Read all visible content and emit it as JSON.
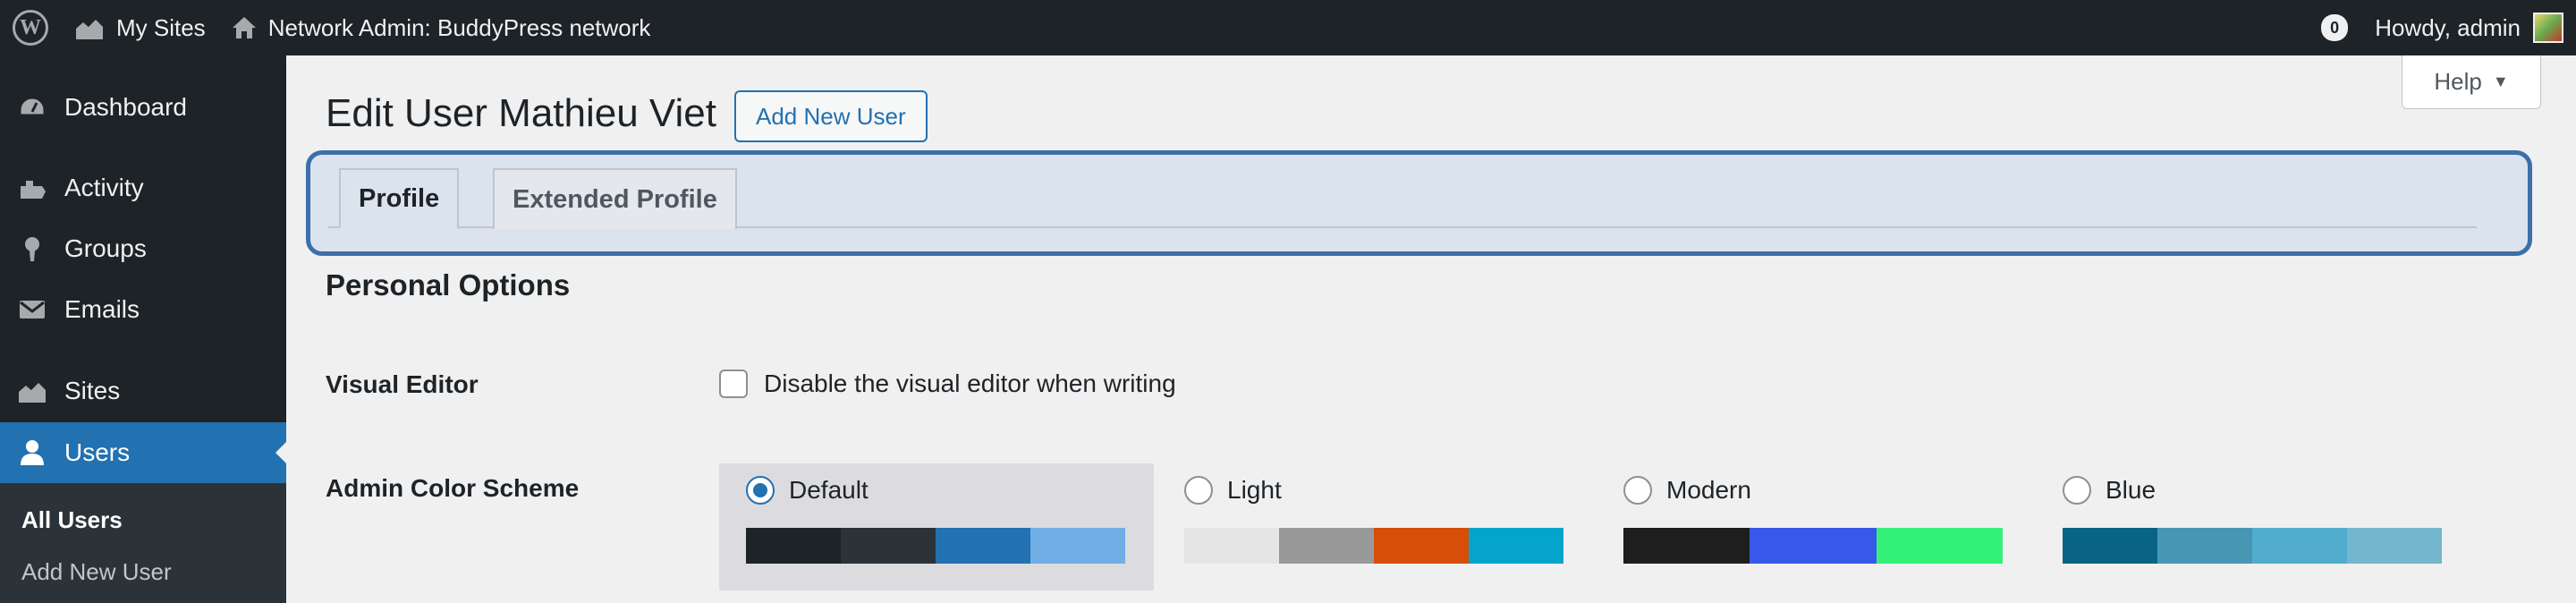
{
  "adminbar": {
    "my_sites": "My Sites",
    "network_admin": "Network Admin: BuddyPress network",
    "notifications_count": "0",
    "howdy": "Howdy, admin"
  },
  "sidebar": {
    "items": [
      {
        "label": "Dashboard",
        "icon": "dashboard-icon"
      },
      {
        "label": "Activity",
        "icon": "activity-icon"
      },
      {
        "label": "Groups",
        "icon": "groups-icon"
      },
      {
        "label": "Emails",
        "icon": "email-icon"
      },
      {
        "label": "Sites",
        "icon": "sites-icon"
      },
      {
        "label": "Users",
        "icon": "users-icon",
        "current": true
      }
    ],
    "submenu": [
      {
        "label": "All Users",
        "current": true
      },
      {
        "label": "Add New User"
      }
    ]
  },
  "header": {
    "help": "Help",
    "title": "Edit User Mathieu Viet",
    "add_new": "Add New User"
  },
  "tabs": [
    {
      "label": "Profile",
      "active": true
    },
    {
      "label": "Extended Profile",
      "active": false
    }
  ],
  "personal_options": {
    "title": "Personal Options",
    "visual_editor_label": "Visual Editor",
    "visual_editor_checkbox": "Disable the visual editor when writing",
    "visual_editor_checked": false,
    "color_scheme_label": "Admin Color Scheme",
    "schemes": [
      {
        "name": "Default",
        "selected": true,
        "colors": [
          "#1d2327",
          "#2c3338",
          "#2271b1",
          "#72aee6"
        ]
      },
      {
        "name": "Light",
        "selected": false,
        "colors": [
          "#e5e5e5",
          "#999999",
          "#d64e07",
          "#04a4cc"
        ]
      },
      {
        "name": "Modern",
        "selected": false,
        "colors": [
          "#1e1e1e",
          "#3858e9",
          "#33f078"
        ]
      },
      {
        "name": "Blue",
        "selected": false,
        "colors": [
          "#096484",
          "#4796b3",
          "#52accc",
          "#74b6ce"
        ]
      }
    ]
  },
  "colors": {
    "admin_bar": "#1d2327",
    "accent": "#2271b1",
    "highlight_frame": "#3d6fa8"
  }
}
